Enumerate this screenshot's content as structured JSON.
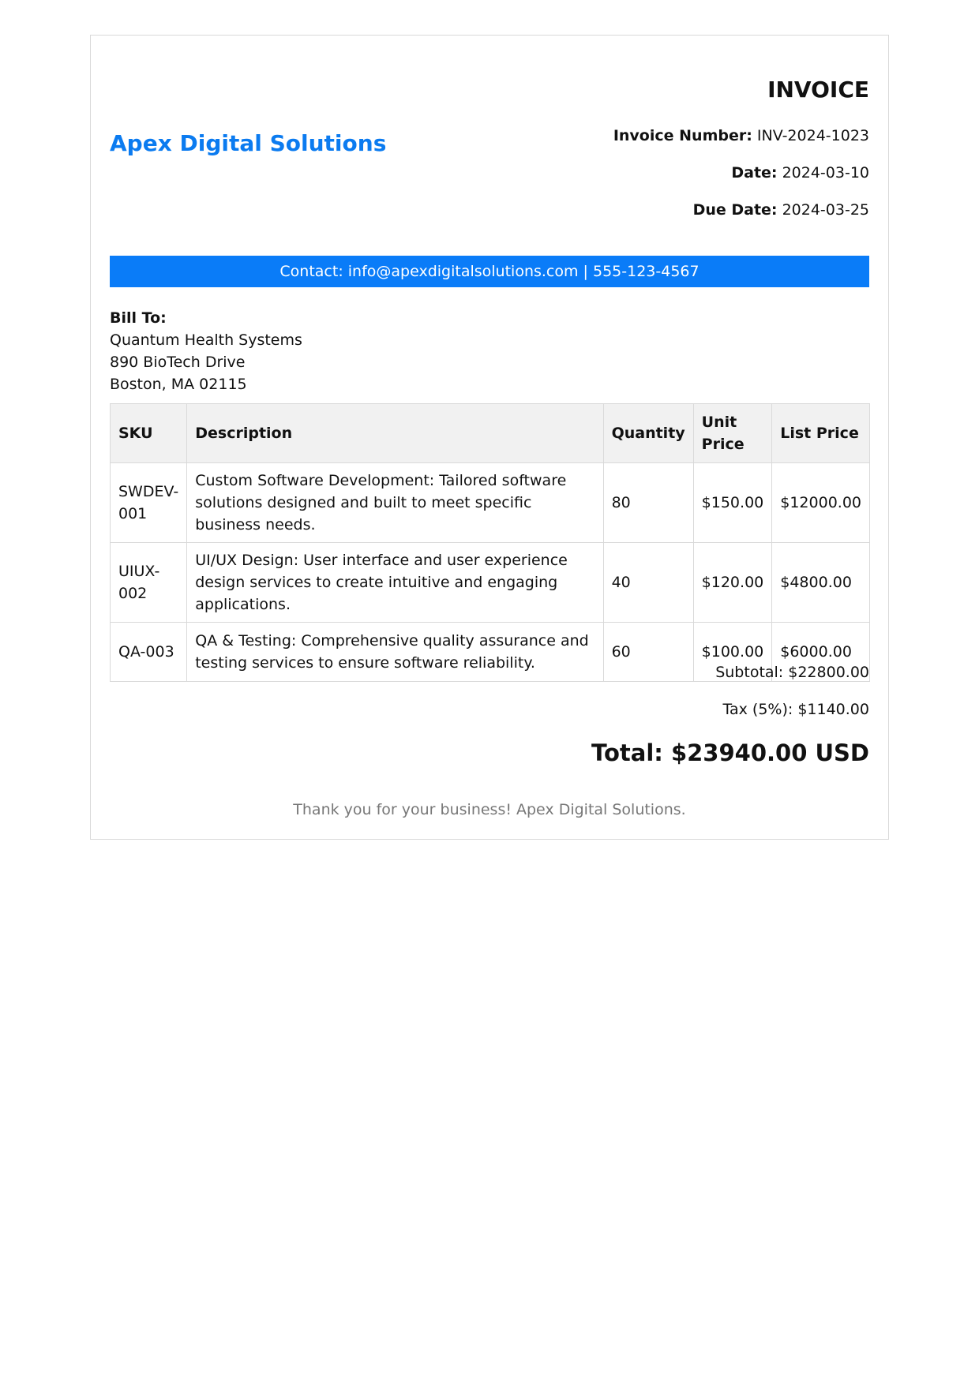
{
  "company": {
    "name": "Apex Digital Solutions"
  },
  "invoice": {
    "title": "INVOICE",
    "number_label": "Invoice Number:",
    "number": "INV-2024-1023",
    "date_label": "Date:",
    "date": "2024-03-10",
    "due_label": "Due Date:",
    "due_date": "2024-03-25"
  },
  "contact": {
    "text": "Contact: info@apexdigitalsolutions.com | 555-123-4567"
  },
  "bill_to": {
    "label": "Bill To:",
    "name": "Quantum Health Systems",
    "street": "890 BioTech Drive",
    "city": "Boston, MA 02115"
  },
  "table": {
    "headers": {
      "sku": "SKU",
      "description": "Description",
      "quantity": "Quantity",
      "unit_price": "Unit Price",
      "list_price": "List Price"
    },
    "rows": [
      {
        "sku": "SWDEV-001",
        "description": "Custom Software Development: Tailored software solutions designed and built to meet specific business needs.",
        "quantity": "80",
        "unit_price": "$150.00",
        "list_price": "$12000.00"
      },
      {
        "sku": "UIUX-002",
        "description": "UI/UX Design: User interface and user experience design services to create intuitive and engaging applications.",
        "quantity": "40",
        "unit_price": "$120.00",
        "list_price": "$4800.00"
      },
      {
        "sku": "QA-003",
        "description": "QA & Testing: Comprehensive quality assurance and testing services to ensure software reliability.",
        "quantity": "60",
        "unit_price": "$100.00",
        "list_price": "$6000.00"
      }
    ]
  },
  "summary": {
    "subtotal": "Subtotal: $22800.00",
    "tax": "Tax (5%): $1140.00",
    "total": "Total: $23940.00 USD"
  },
  "footer": {
    "note": "Thank you for your business! Apex Digital Solutions."
  },
  "colors": {
    "brand": "#0b7bf0",
    "contact_bar": "#0a7cf8",
    "table_header_bg": "#f1f1f1",
    "border": "#d9d9d9",
    "footer_text": "#777777"
  }
}
